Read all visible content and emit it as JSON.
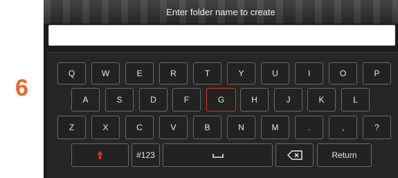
{
  "step_number": "6",
  "dialog": {
    "prompt": "Enter folder name to create",
    "input_value": ""
  },
  "keyboard": {
    "row1": [
      "Q",
      "W",
      "E",
      "R",
      "T",
      "Y",
      "U",
      "I",
      "O",
      "P"
    ],
    "row2": [
      "A",
      "S",
      "D",
      "F",
      "G",
      "H",
      "J",
      "K",
      "L"
    ],
    "row3": [
      "Z",
      "X",
      "C",
      "V",
      "B",
      "N",
      "M",
      ".",
      ",",
      "?"
    ],
    "numbers_label": "#123",
    "return_label": "Return",
    "selected_key": "G",
    "shift_icon": "shift-arrow-icon",
    "space_icon": "space-bar-icon",
    "backspace_icon": "backspace-icon"
  },
  "colors": {
    "accent_orange": "#f26522",
    "selected_key_border": "#d23a1c",
    "shift_icon": "#e0301e"
  }
}
